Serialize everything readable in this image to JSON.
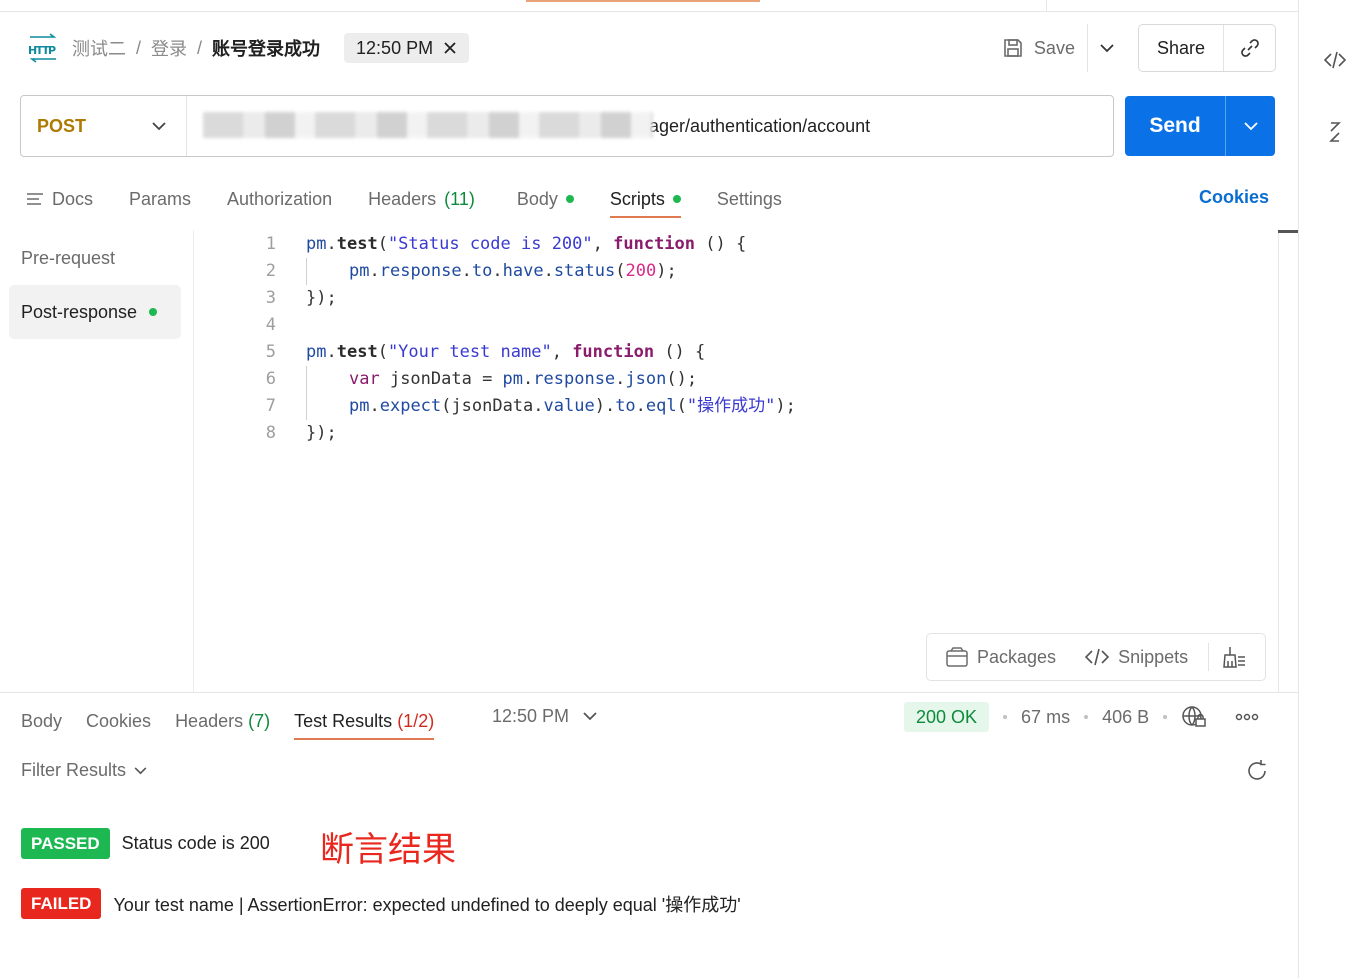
{
  "header": {
    "breadcrumb": [
      "测试二",
      "登录"
    ],
    "current": "账号登录成功",
    "time_chip": "12:50 PM",
    "save_label": "Save",
    "share_label": "Share"
  },
  "request": {
    "method": "POST",
    "url_visible": "ager/authentication/account",
    "send_label": "Send"
  },
  "request_tabs": {
    "docs": "Docs",
    "params": "Params",
    "authorization": "Authorization",
    "headers": "Headers",
    "headers_count": "(11)",
    "body": "Body",
    "scripts": "Scripts",
    "settings": "Settings",
    "cookies": "Cookies"
  },
  "script_sidebar": {
    "pre_request": "Pre-request",
    "post_response": "Post-response"
  },
  "code": {
    "line_numbers": [
      "1",
      "2",
      "3",
      "4",
      "5",
      "6",
      "7",
      "8"
    ],
    "l1": [
      "pm",
      ".",
      "test",
      "(",
      "\"Status code is 200\"",
      ", ",
      "function",
      " () {"
    ],
    "l2": [
      "pm",
      ".",
      "response",
      ".",
      "to",
      ".",
      "have",
      ".",
      "status",
      "(",
      "200",
      ");"
    ],
    "l3": "});",
    "l5": [
      "pm",
      ".",
      "test",
      "(",
      "\"Your test name\"",
      ", ",
      "function",
      " () {"
    ],
    "l6": [
      "var",
      " jsonData = ",
      "pm",
      ".",
      "response",
      ".",
      "json",
      "();"
    ],
    "l7": [
      "pm",
      ".",
      "expect",
      "(jsonData.",
      "value",
      ").",
      "to",
      ".",
      "eql",
      "(",
      "\"操作成功\"",
      ");"
    ],
    "l8": "});"
  },
  "editor_tools": {
    "packages": "Packages",
    "snippets": "Snippets"
  },
  "response": {
    "tabs": {
      "body": "Body",
      "cookies": "Cookies",
      "headers": "Headers",
      "headers_count": "(7)",
      "test_results": "Test Results",
      "test_results_count": "(1/2)"
    },
    "time": "12:50 PM",
    "status": "200 OK",
    "duration": "67 ms",
    "size": "406 B",
    "filter_label": "Filter Results",
    "results": [
      {
        "badge": "PASSED",
        "text": "Status code is 200"
      },
      {
        "badge": "FAILED",
        "text": "Your test name | AssertionError: expected undefined to deeply equal '操作成功'"
      }
    ],
    "annotation": "断言结果"
  },
  "colors": {
    "accent": "#e07a52",
    "send": "#0a72e6",
    "passed": "#1db851",
    "failed": "#e8271e",
    "method": "#ad7a03"
  }
}
